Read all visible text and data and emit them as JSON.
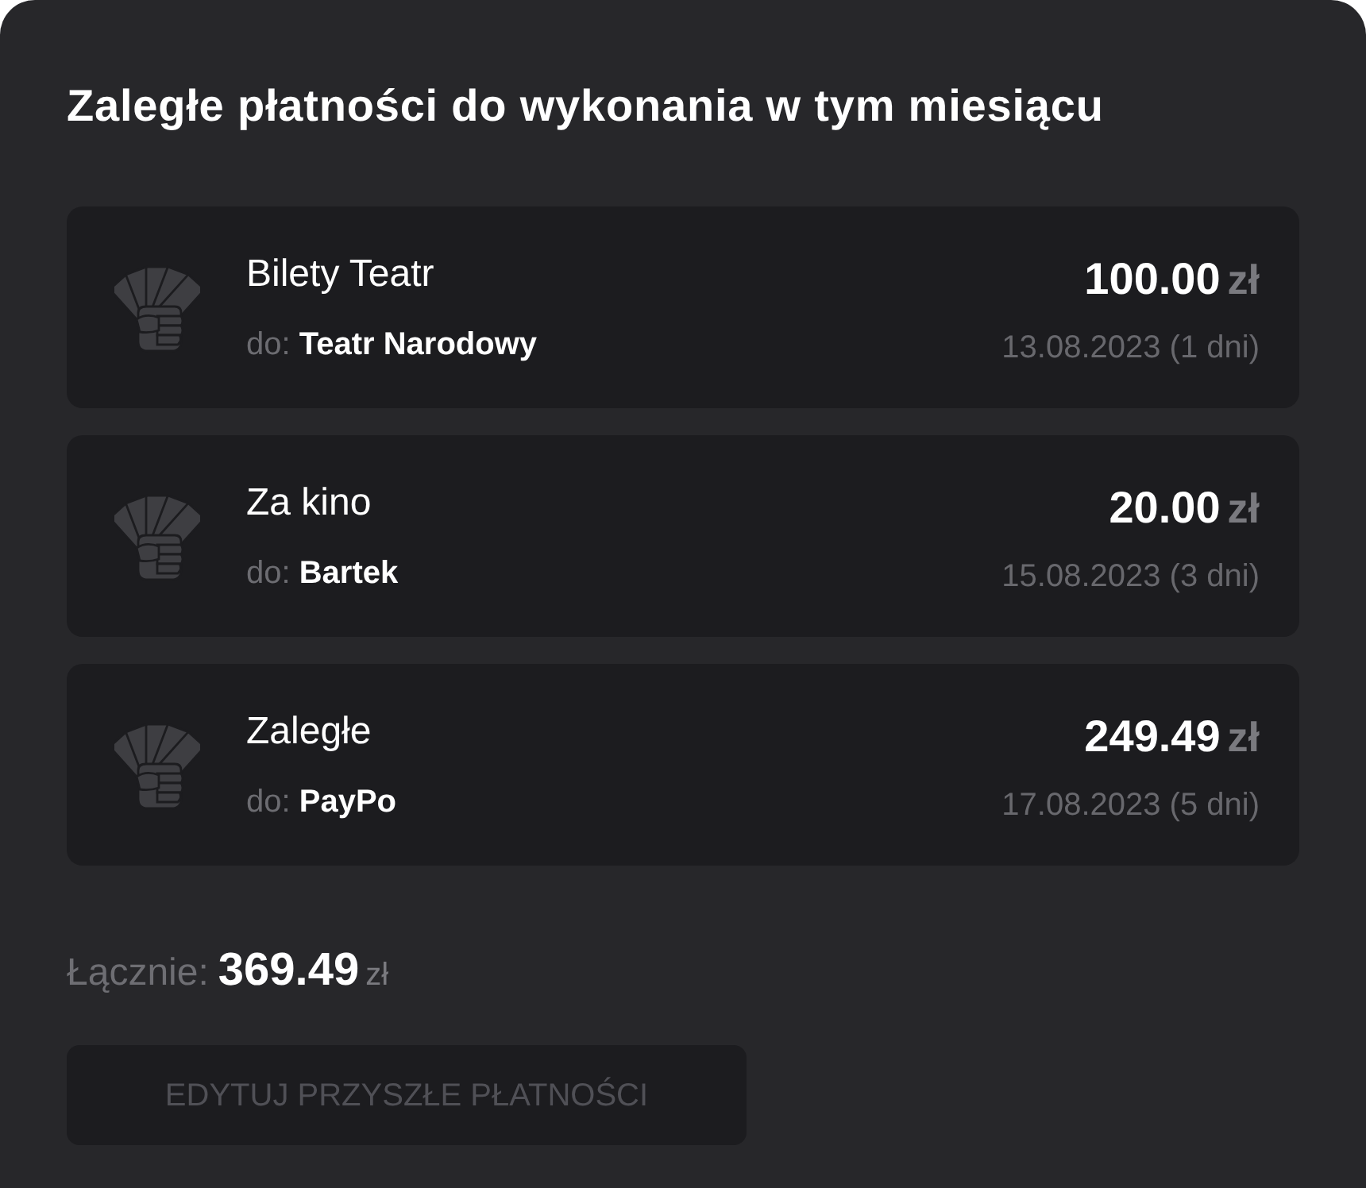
{
  "title": "Zaległe płatności do wykonania w tym miesiącu",
  "payments": [
    {
      "name": "Bilety Teatr",
      "recipient": "do: **Teatr Narodowy**",
      "amount": "100.00",
      "currency": "zł",
      "due": "13.08.2023 (1 dni)"
    },
    {
      "name": "Za kino",
      "recipient": "do: **Bartek**",
      "amount": "20.00",
      "currency": "zł",
      "due": "15.08.2023 (3 dni)"
    },
    {
      "name": "Zaległe",
      "recipient": "do: **PayPo**",
      "amount": "249.49",
      "currency": "zł",
      "due": "17.08.2023 (5 dni)"
    }
  ],
  "total": {
    "label": "Łącznie:",
    "amount": "369.49",
    "currency": "zł"
  },
  "edit_button": {
    "label": "EDYTUJ PRZYSZŁE PŁATNOŚCI",
    "disabled": true
  }
}
